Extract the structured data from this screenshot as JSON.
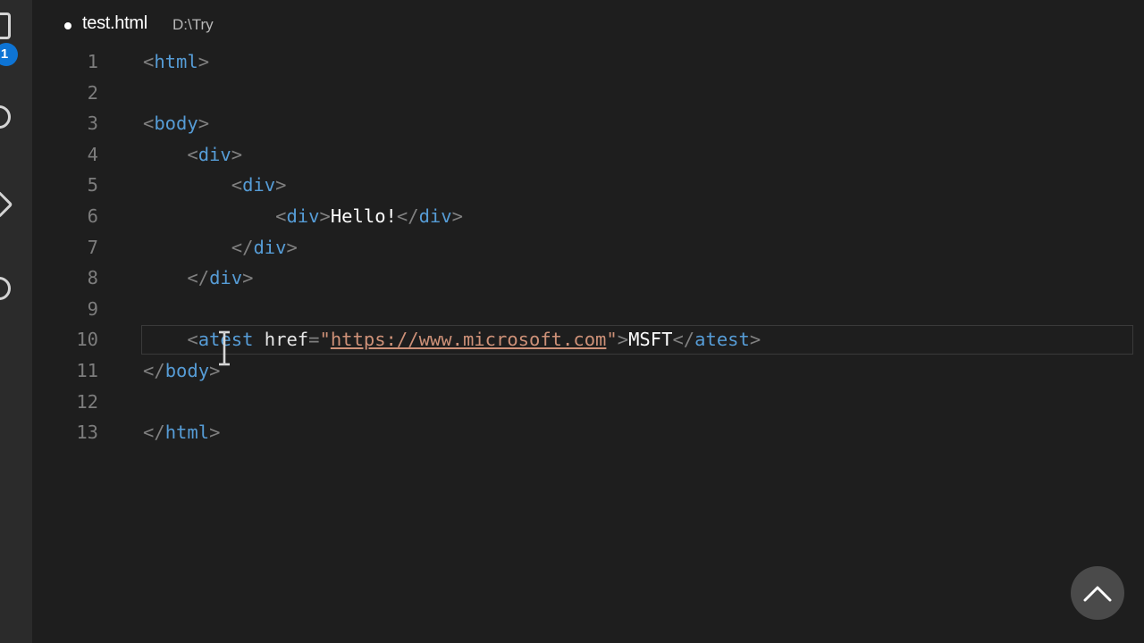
{
  "activity_bar": {
    "badge_count": "1",
    "icons": [
      "files-icon",
      "search-icon",
      "source-control-icon",
      "extensions-icon"
    ]
  },
  "tab": {
    "filename": "test.html",
    "path": "D:\\Try",
    "modified": true
  },
  "editor": {
    "current_line": 10,
    "colors": {
      "bracket": "#808080",
      "tag": "#569cd6",
      "string": "#ce9178",
      "text": "#ffffff",
      "line_number": "#7d7d7d",
      "background": "#1e1e1e"
    },
    "lines": [
      {
        "n": "1",
        "tokens": [
          [
            "br",
            "<"
          ],
          [
            "tg",
            "html"
          ],
          [
            "br",
            ">"
          ]
        ]
      },
      {
        "n": "2",
        "tokens": []
      },
      {
        "n": "3",
        "tokens": [
          [
            "br",
            "<"
          ],
          [
            "tg",
            "body"
          ],
          [
            "br",
            ">"
          ]
        ]
      },
      {
        "n": "4",
        "tokens": [
          [
            "tx",
            "    "
          ],
          [
            "br",
            "<"
          ],
          [
            "tg",
            "div"
          ],
          [
            "br",
            ">"
          ]
        ]
      },
      {
        "n": "5",
        "tokens": [
          [
            "tx",
            "        "
          ],
          [
            "br",
            "<"
          ],
          [
            "tg",
            "div"
          ],
          [
            "br",
            ">"
          ]
        ]
      },
      {
        "n": "6",
        "tokens": [
          [
            "tx",
            "            "
          ],
          [
            "br",
            "<"
          ],
          [
            "tg",
            "div"
          ],
          [
            "br",
            ">"
          ],
          [
            "tx",
            "Hello!"
          ],
          [
            "br",
            "</"
          ],
          [
            "tg",
            "div"
          ],
          [
            "br",
            ">"
          ]
        ]
      },
      {
        "n": "7",
        "tokens": [
          [
            "tx",
            "        "
          ],
          [
            "br",
            "</"
          ],
          [
            "tg",
            "div"
          ],
          [
            "br",
            ">"
          ]
        ]
      },
      {
        "n": "8",
        "tokens": [
          [
            "tx",
            "    "
          ],
          [
            "br",
            "</"
          ],
          [
            "tg",
            "div"
          ],
          [
            "br",
            ">"
          ]
        ]
      },
      {
        "n": "9",
        "tokens": []
      },
      {
        "n": "10",
        "tokens": [
          [
            "tx",
            "    "
          ],
          [
            "br",
            "<"
          ],
          [
            "tg",
            "atest"
          ],
          [
            "tx",
            " "
          ],
          [
            "at",
            "href"
          ],
          [
            "eq",
            "="
          ],
          [
            "st",
            "\""
          ],
          [
            "url",
            "https://www.microsoft.com"
          ],
          [
            "st",
            "\""
          ],
          [
            "br",
            ">"
          ],
          [
            "tx",
            "MSFT"
          ],
          [
            "br",
            "</"
          ],
          [
            "tg",
            "atest"
          ],
          [
            "br",
            ">"
          ]
        ]
      },
      {
        "n": "11",
        "tokens": [
          [
            "br",
            "</"
          ],
          [
            "tg",
            "body"
          ],
          [
            "br",
            ">"
          ]
        ]
      },
      {
        "n": "12",
        "tokens": []
      },
      {
        "n": "13",
        "tokens": [
          [
            "br",
            "</"
          ],
          [
            "tg",
            "html"
          ],
          [
            "br",
            ">"
          ]
        ]
      }
    ]
  },
  "scroll_to_top": {
    "icon": "chevron-up-icon"
  }
}
